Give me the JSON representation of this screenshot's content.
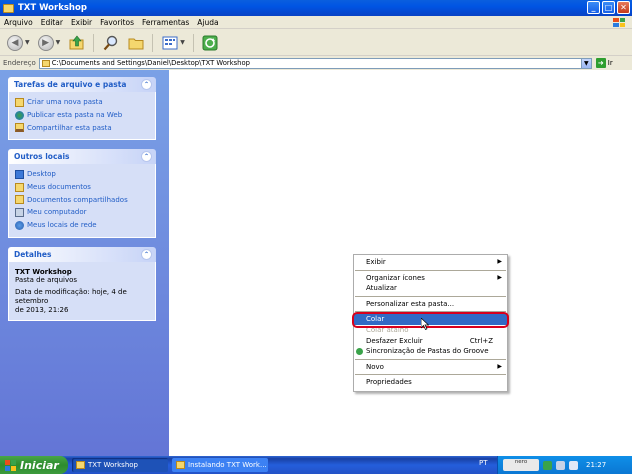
{
  "window": {
    "title": "TXT Workshop",
    "buttons": {
      "minimize": "_",
      "maximize": "□",
      "close": "✕"
    }
  },
  "menubar": [
    "Arquivo",
    "Editar",
    "Exibir",
    "Favoritos",
    "Ferramentas",
    "Ajuda"
  ],
  "toolbar": {
    "icons": [
      "back-icon",
      "forward-icon",
      "up-folder-icon",
      "search-icon",
      "folders-icon",
      "views-icon",
      "sync-icon"
    ]
  },
  "address": {
    "label": "Endereço",
    "path": "C:\\Documents and Settings\\Daniel\\Desktop\\TXT Workshop",
    "go_label": "Ir"
  },
  "sidebar": {
    "tasks": {
      "title": "Tarefas de arquivo e pasta",
      "items": [
        "Criar uma nova pasta",
        "Publicar esta pasta na Web",
        "Compartilhar esta pasta"
      ]
    },
    "places": {
      "title": "Outros locais",
      "items": [
        "Desktop",
        "Meus documentos",
        "Documentos compartilhados",
        "Meu computador",
        "Meus locais de rede"
      ]
    },
    "details": {
      "title": "Detalhes",
      "name": "TXT Workshop",
      "type": "Pasta de arquivos",
      "modified_line1": "Data de modificação: hoje, 4 de setembro",
      "modified_line2": "de 2013, 21:26"
    }
  },
  "context_menu": {
    "items": [
      {
        "label": "Exibir",
        "submenu": true
      },
      {
        "sep": true
      },
      {
        "label": "Organizar ícones",
        "submenu": true
      },
      {
        "label": "Atualizar"
      },
      {
        "sep": true
      },
      {
        "label": "Personalizar esta pasta..."
      },
      {
        "sep": true
      },
      {
        "label": "Colar",
        "selected": true
      },
      {
        "label": "Colar atalho",
        "disabled": true
      },
      {
        "label": "Desfazer Excluir",
        "shortcut": "Ctrl+Z"
      },
      {
        "label": "Sincronização de Pastas do Groove",
        "icon": true
      },
      {
        "sep": true
      },
      {
        "label": "Novo",
        "submenu": true
      },
      {
        "sep": true
      },
      {
        "label": "Propriedades"
      }
    ]
  },
  "taskbar": {
    "start_label": "Iniciar",
    "tasks": [
      {
        "label": "TXT Workshop",
        "active": true
      },
      {
        "label": "Instalando TXT Work...",
        "active": false
      }
    ],
    "language": "PT",
    "nero_label": "nero",
    "clock": "21:27"
  },
  "colors": {
    "titlebar": "#0054e3",
    "sidebar_bg": "#6f8be0",
    "link": "#215dc6",
    "menu_selection": "#316ac5",
    "highlight_ring": "#d8001c",
    "start_button": "#3c9a3c"
  }
}
